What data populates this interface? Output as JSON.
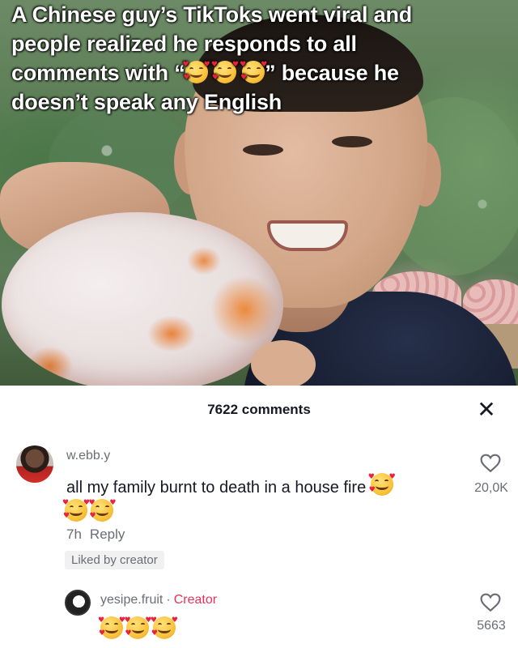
{
  "headline": {
    "line1": "A Chinese guy’s TikToks went viral and",
    "line2": "people realized he responds to all",
    "line3_pre": "comments with “",
    "line3_post": "” because he",
    "line4": "doesn’t speak any English",
    "emoji_name": "smiling-face-with-hearts-emoji"
  },
  "comments_panel": {
    "title": "7622 comments",
    "close_glyph": "✕"
  },
  "comment": {
    "username": "w.ebb.y",
    "text": "all my family burnt to death in a house fire",
    "time": "7h",
    "reply_label": "Reply",
    "liked_badge": "Liked by creator",
    "like_count": "20,0K"
  },
  "reply": {
    "username": "yesipe.fruit",
    "separator": "·",
    "creator_label": "Creator",
    "like_count": "5663"
  },
  "colors": {
    "text_primary": "#161823",
    "text_secondary": "#6b6d75",
    "creator_accent": "#e8315a",
    "badge_bg": "#f1f1f2"
  }
}
